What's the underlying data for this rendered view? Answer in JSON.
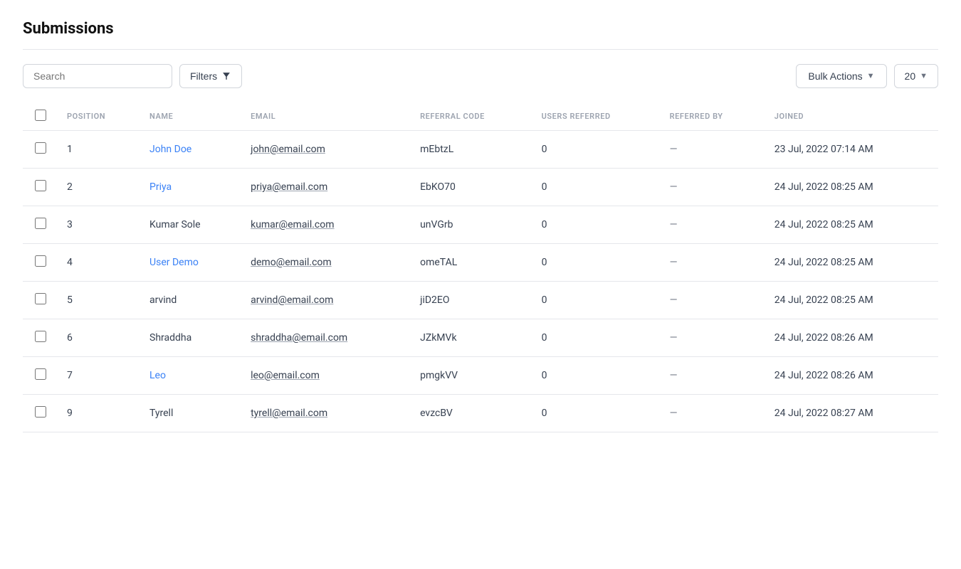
{
  "page": {
    "title": "Submissions"
  },
  "toolbar": {
    "search_placeholder": "Search",
    "filters_label": "Filters",
    "bulk_actions_label": "Bulk Actions",
    "per_page_value": "20"
  },
  "table": {
    "columns": [
      {
        "key": "checkbox",
        "label": ""
      },
      {
        "key": "position",
        "label": "POSITION"
      },
      {
        "key": "name",
        "label": "NAME"
      },
      {
        "key": "email",
        "label": "EMAIL"
      },
      {
        "key": "referral_code",
        "label": "REFERRAL CODE"
      },
      {
        "key": "users_referred",
        "label": "USERS REFERRED"
      },
      {
        "key": "referred_by",
        "label": "REFERRED BY"
      },
      {
        "key": "joined",
        "label": "JOINED"
      }
    ],
    "rows": [
      {
        "position": "1",
        "name": "John Doe",
        "email": "john@email.com",
        "referral_code": "mEbtzL",
        "users_referred": "0",
        "referred_by": "—",
        "joined": "23 Jul, 2022 07:14 AM",
        "name_linked": true
      },
      {
        "position": "2",
        "name": "Priya",
        "email": "priya@email.com",
        "referral_code": "EbKO70",
        "users_referred": "0",
        "referred_by": "—",
        "joined": "24 Jul, 2022 08:25 AM",
        "name_linked": true
      },
      {
        "position": "3",
        "name": "Kumar Sole",
        "email": "kumar@email.com",
        "referral_code": "unVGrb",
        "users_referred": "0",
        "referred_by": "—",
        "joined": "24 Jul, 2022 08:25 AM",
        "name_linked": false
      },
      {
        "position": "4",
        "name": "User Demo",
        "email": "demo@email.com",
        "referral_code": "omeTAL",
        "users_referred": "0",
        "referred_by": "—",
        "joined": "24 Jul, 2022 08:25 AM",
        "name_linked": true
      },
      {
        "position": "5",
        "name": "arvind",
        "email": "arvind@email.com",
        "referral_code": "jiD2EO",
        "users_referred": "0",
        "referred_by": "—",
        "joined": "24 Jul, 2022 08:25 AM",
        "name_linked": false
      },
      {
        "position": "6",
        "name": "Shraddha",
        "email": "shraddha@email.com",
        "referral_code": "JZkMVk",
        "users_referred": "0",
        "referred_by": "—",
        "joined": "24 Jul, 2022 08:26 AM",
        "name_linked": false
      },
      {
        "position": "7",
        "name": "Leo",
        "email": "leo@email.com",
        "referral_code": "pmgkVV",
        "users_referred": "0",
        "referred_by": "—",
        "joined": "24 Jul, 2022 08:26 AM",
        "name_linked": true
      },
      {
        "position": "9",
        "name": "Tyrell",
        "email": "tyrell@email.com",
        "referral_code": "evzcBV",
        "users_referred": "0",
        "referred_by": "—",
        "joined": "24 Jul, 2022 08:27 AM",
        "name_linked": false
      }
    ]
  }
}
